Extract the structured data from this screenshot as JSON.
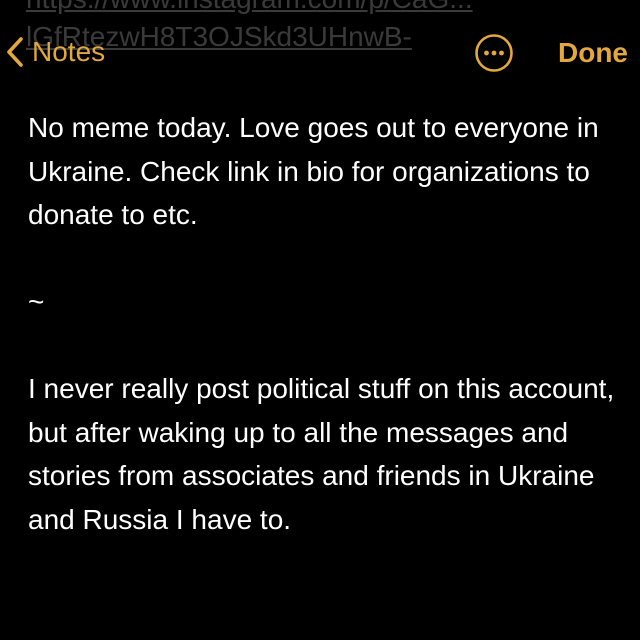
{
  "nav": {
    "back_label": "Notes",
    "done_label": "Done",
    "accent_color": "#e2a83b",
    "back_icon": "chevron-left-icon",
    "more_icon": "ellipsis-circle-icon"
  },
  "scrolled": {
    "line1": "https://www.instagram.com/p/CaG...",
    "line2": "lGfRtezwH8T3OJSkd3UHnwB-"
  },
  "note": {
    "paragraph1": "No meme today. Love goes out to everyone in Ukraine. Check link in bio for organizations to donate to etc.",
    "separator": "~",
    "paragraph2": "I never really post political stuff on this account, but after waking up to all the messages and stories from associates and friends in Ukraine and Russia I have to."
  }
}
